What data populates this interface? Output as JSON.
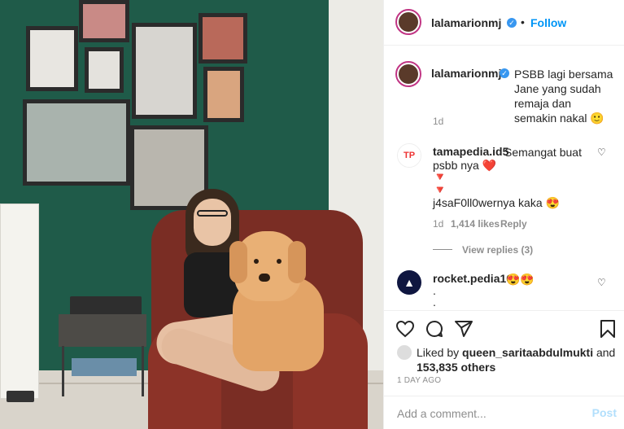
{
  "post": {
    "username": "lalamarionmj",
    "follow_label": "Follow",
    "dot": "•",
    "caption": "PSBB lagi bersama Jane yang sudah remaja dan semakin nakal 🙂",
    "caption_age": "1d"
  },
  "comments": [
    {
      "username": "tamapedia.id5",
      "text_line1": "Semangat buat",
      "text_line2": "psbb nya ❤️",
      "text_line3": "🔻",
      "text_line4": "🔻",
      "text_line5": "j4saF0ll0wernya kaka 😍",
      "age": "1d",
      "likes": "1,414 likes",
      "reply_label": "Reply",
      "view_replies": "View replies (3)"
    },
    {
      "username": "rocket.pedia16",
      "text_line1": "😍😍",
      "text_line2": ".",
      "text_line3": "."
    }
  ],
  "likes": {
    "prefix": "Liked by",
    "user": "queen_saritaabdulmukti",
    "connector": "and",
    "count": "153,835 others"
  },
  "posted_ago": "1 DAY AGO",
  "add_comment": {
    "placeholder": "Add a comment...",
    "post_label": "Post"
  },
  "icons": {
    "verified": "verified-badge-icon",
    "like": "heart-icon",
    "comment": "comment-icon",
    "share": "share-icon",
    "save": "bookmark-icon"
  },
  "colors": {
    "accent": "#0095f6",
    "verified": "#3897f0",
    "wall": "#1f5b49"
  }
}
